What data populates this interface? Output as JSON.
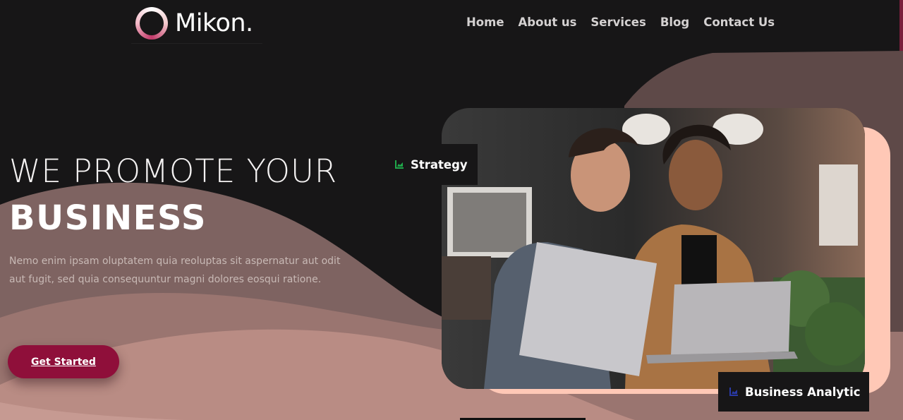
{
  "brand": {
    "name": "Mikon."
  },
  "nav": {
    "items": [
      {
        "label": "Home"
      },
      {
        "label": "About us"
      },
      {
        "label": "Services"
      },
      {
        "label": "Blog"
      },
      {
        "label": "Contact Us"
      }
    ]
  },
  "hero": {
    "heading_line1": "WE PROMOTE YOUR",
    "heading_line2": "BUSINESS",
    "description": "Nemo enim ipsam oluptatem quia reoluptas sit aspernatur aut odit aut fugit, sed quia consequuntur magni dolores eosqui ratione.",
    "cta_label": "Get Started"
  },
  "badges": {
    "strategy": {
      "label": "Strategy",
      "icon": "chart-icon",
      "icon_color": "#1fa84a"
    },
    "analytic": {
      "label": "Business Analytic",
      "icon": "chart-icon",
      "icon_color": "#1f2a8a"
    }
  },
  "colors": {
    "background": "#171617",
    "accent": "#8f0f3a",
    "wave_dark": "#5e4948",
    "wave_mid": "#7e6361",
    "wave_light": "#b98c84",
    "photo_frame": "#ffc8b6"
  }
}
